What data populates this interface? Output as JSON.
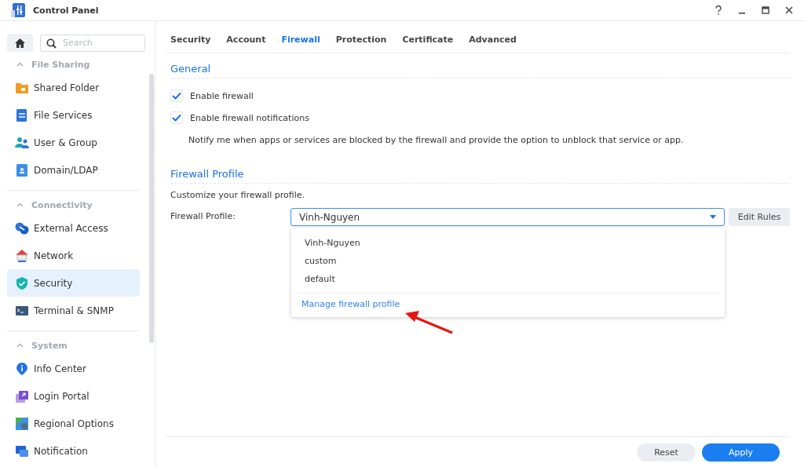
{
  "window": {
    "title": "Control Panel"
  },
  "sidebar": {
    "search": {
      "placeholder": "Search"
    },
    "sections": [
      {
        "title": "File Sharing",
        "expanded": true,
        "items": [
          {
            "label": "Shared Folder",
            "selected": false
          },
          {
            "label": "File Services",
            "selected": false
          },
          {
            "label": "User & Group",
            "selected": false
          },
          {
            "label": "Domain/LDAP",
            "selected": false
          }
        ]
      },
      {
        "title": "Connectivity",
        "expanded": true,
        "items": [
          {
            "label": "External Access",
            "selected": false
          },
          {
            "label": "Network",
            "selected": false
          },
          {
            "label": "Security",
            "selected": true
          },
          {
            "label": "Terminal & SNMP",
            "selected": false
          }
        ]
      },
      {
        "title": "System",
        "expanded": true,
        "items": [
          {
            "label": "Info Center",
            "selected": false
          },
          {
            "label": "Login Portal",
            "selected": false
          },
          {
            "label": "Regional Options",
            "selected": false
          },
          {
            "label": "Notification",
            "selected": false
          }
        ]
      }
    ]
  },
  "tabs": [
    {
      "label": "Security",
      "selected": false
    },
    {
      "label": "Account",
      "selected": false
    },
    {
      "label": "Firewall",
      "selected": true
    },
    {
      "label": "Protection",
      "selected": false
    },
    {
      "label": "Certificate",
      "selected": false
    },
    {
      "label": "Advanced",
      "selected": false
    }
  ],
  "general": {
    "title": "General",
    "options": [
      {
        "label": "Enable firewall",
        "checked": true
      },
      {
        "label": "Enable firewall notifications",
        "checked": true
      }
    ],
    "note": "Notify me when apps or services are blocked by the firewall and provide the option to unblock that service or app."
  },
  "profile": {
    "title": "Firewall Profile",
    "description": "Customize your firewall profile.",
    "field_label": "Firewall Profile:",
    "value": "Vinh-Nguyen",
    "expanded": true,
    "options": [
      "Vinh-Nguyen",
      "custom",
      "default"
    ],
    "manage_link": "Manage firewall profile",
    "edit_button": "Edit Rules"
  },
  "footer": {
    "buttons": [
      {
        "label": "Reset",
        "kind": "secondary"
      },
      {
        "label": "Apply",
        "kind": "primary"
      }
    ]
  }
}
